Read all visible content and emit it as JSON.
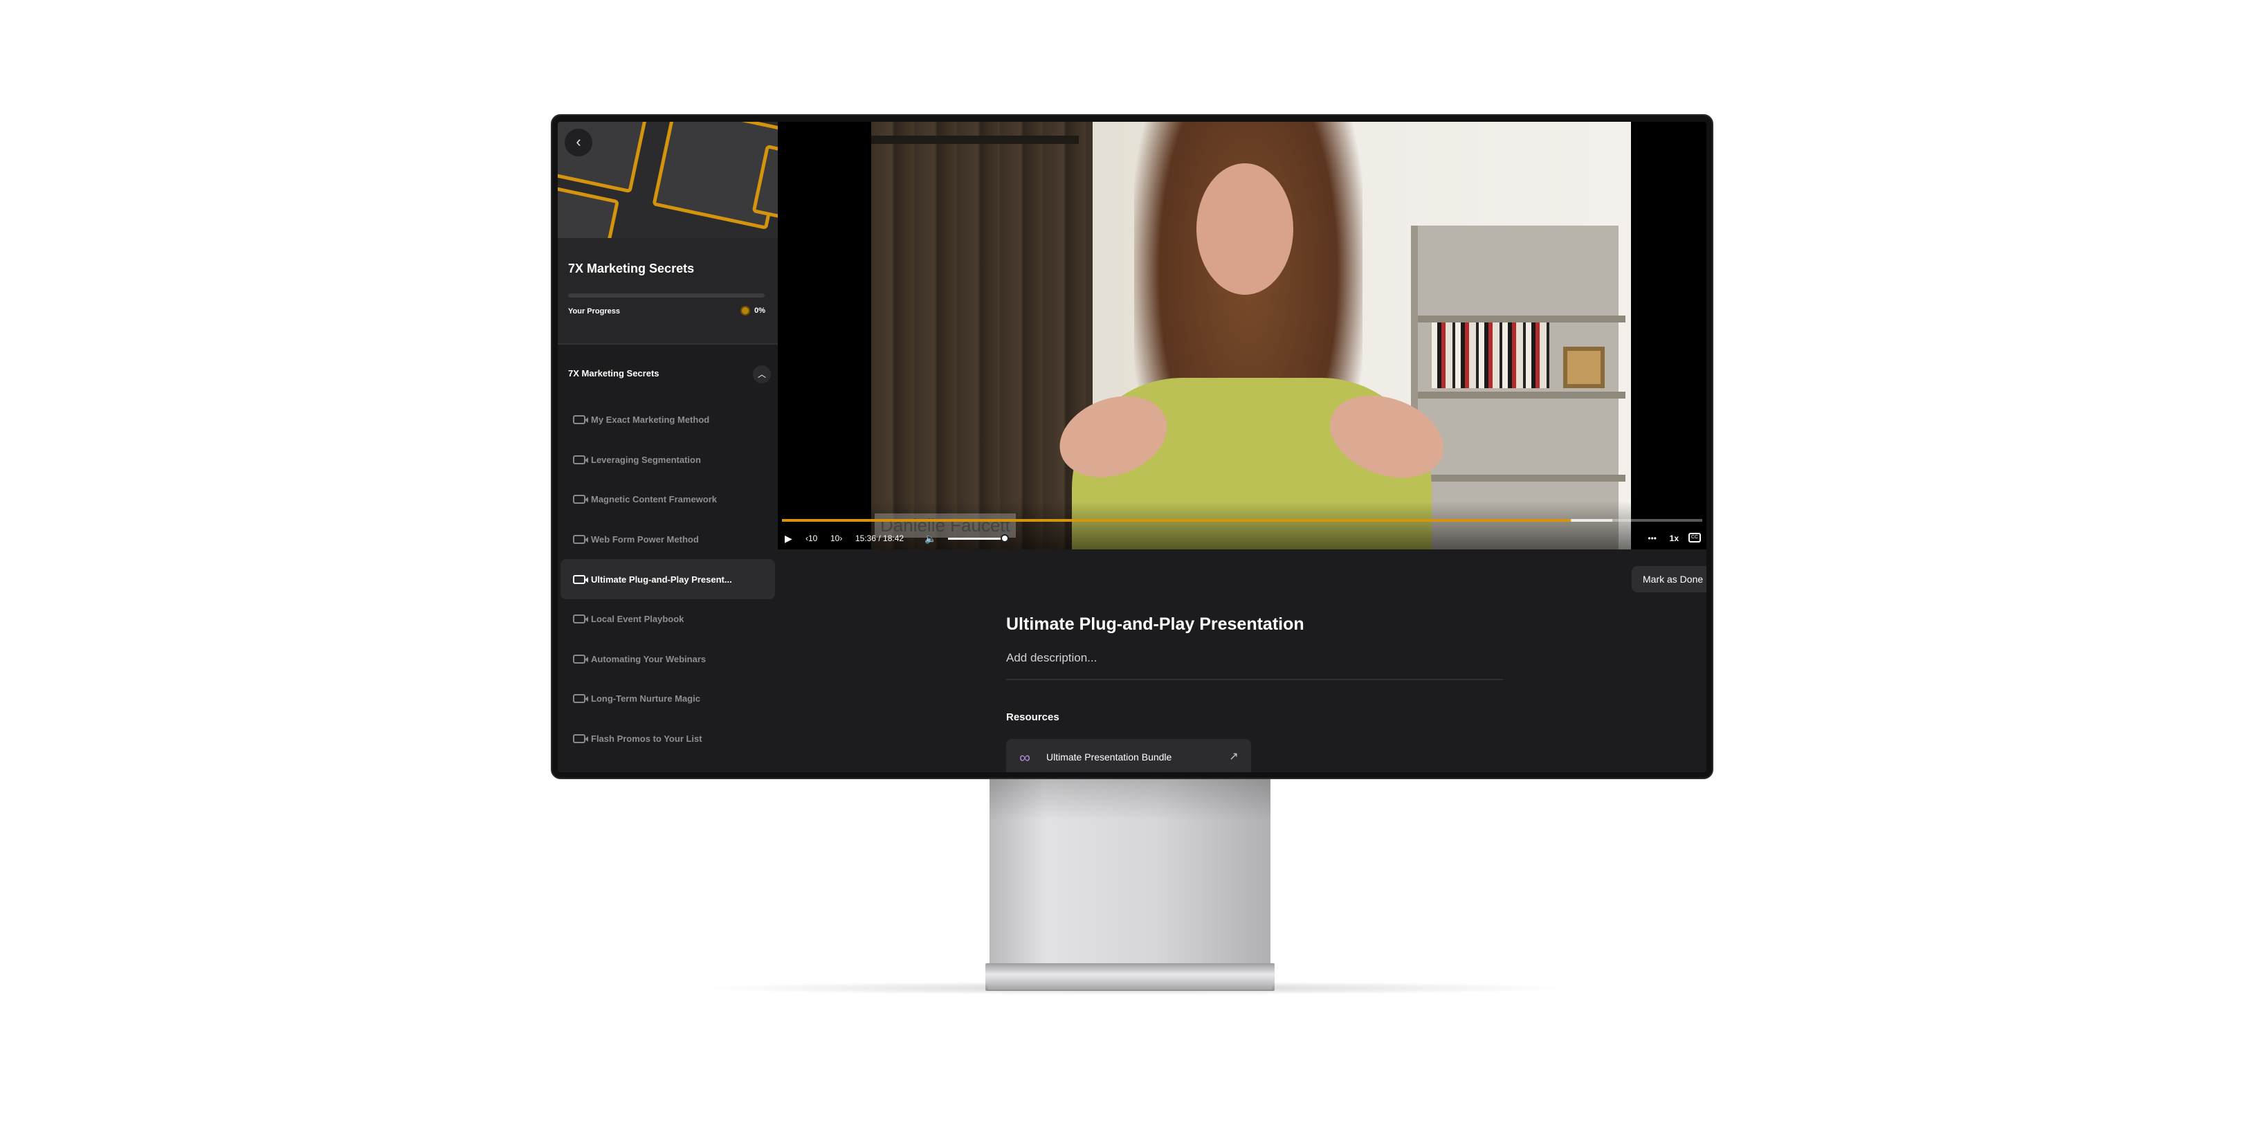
{
  "course": {
    "title": "7X Marketing Secrets",
    "progress_label": "Your Progress",
    "progress_percent": "0%",
    "progress_fraction": 0
  },
  "module": {
    "title": "7X Marketing Secrets",
    "lessons": [
      {
        "label": "My Exact Marketing Method"
      },
      {
        "label": "Leveraging Segmentation"
      },
      {
        "label": "Magnetic Content Framework"
      },
      {
        "label": "Web Form Power Method"
      },
      {
        "label": "Ultimate Plug-and-Play Present..."
      },
      {
        "label": "Local Event Playbook"
      },
      {
        "label": "Automating Your Webinars"
      },
      {
        "label": "Long-Term Nurture Magic"
      },
      {
        "label": "Flash Promos to Your List"
      }
    ],
    "active_index": 4
  },
  "player": {
    "caption_text": "Danielle Faucett",
    "skip_back": "10",
    "skip_forward": "10",
    "time": "15:36 / 18:42",
    "played_fraction": 0.858,
    "volume_fraction": 1,
    "speed": "1x",
    "more": "•••",
    "cc": "CC"
  },
  "lesson": {
    "mark_done": "Mark as Done",
    "title": "Ultimate Plug-and-Play Presentation",
    "description_placeholder": "Add description...",
    "resources_heading": "Resources",
    "resources": [
      {
        "label": "Ultimate Presentation Bundle",
        "icon": "link-icon"
      }
    ]
  },
  "colors": {
    "accent": "#d4940e",
    "background": "#1c1c1e",
    "panel": "#262628",
    "resource_icon": "#b58ad8"
  }
}
